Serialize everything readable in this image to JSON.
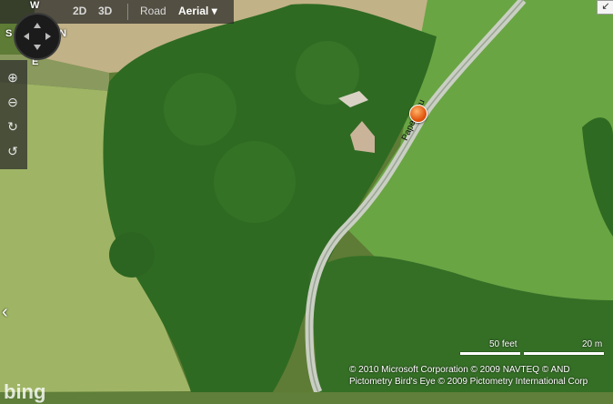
{
  "toolbar": {
    "view_2d": "2D",
    "view_3d": "3D",
    "road": "Road",
    "aerial": "Aerial"
  },
  "compass": {
    "north": "W",
    "west": "S",
    "east": "N",
    "south": "E"
  },
  "controls": {
    "zoom_in": "⊕",
    "zoom_out": "⊖",
    "rotate_cw": "↻",
    "rotate_ccw": "↺"
  },
  "road_label": "Paperwaru",
  "scale": {
    "feet": "50 feet",
    "meters": "20 m"
  },
  "copyright": {
    "line1": "© 2010 Microsoft Corporation   © 2009 NAVTEQ   © AND",
    "line2": "Pictometry Bird's Eye © 2009 Pictometry International Corp"
  },
  "logo": "bing"
}
